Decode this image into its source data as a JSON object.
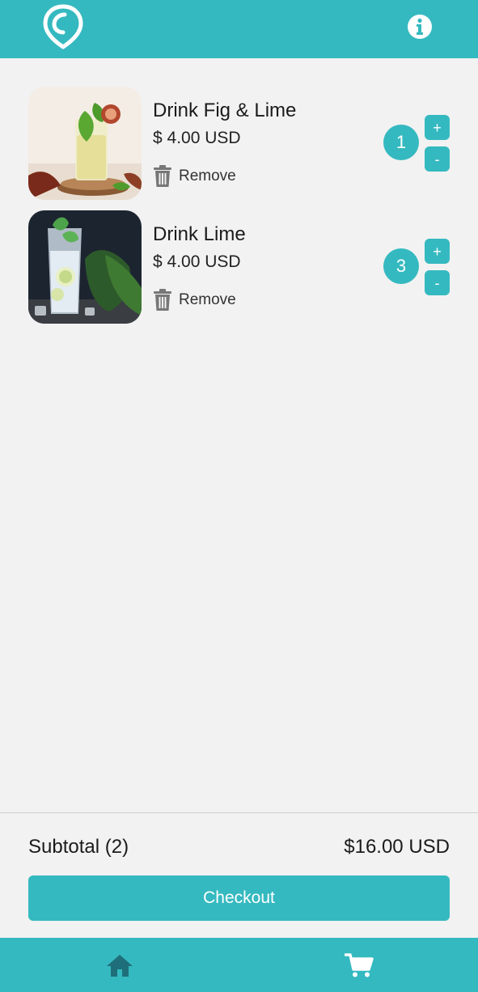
{
  "header": {
    "logo_icon": "location-pin-logo",
    "info_icon": "info-icon",
    "color": "#35b9c0"
  },
  "cart": {
    "items": [
      {
        "name": "Drink Fig & Lime",
        "price": "$ 4.00 USD",
        "remove_label": "Remove",
        "quantity": "1",
        "plus_label": "+",
        "minus_label": "-"
      },
      {
        "name": "Drink Lime",
        "price": "$ 4.00 USD",
        "remove_label": "Remove",
        "quantity": "3",
        "plus_label": "+",
        "minus_label": "-"
      }
    ]
  },
  "summary": {
    "subtotal_label": "Subtotal (2)",
    "subtotal_value": "$16.00 USD",
    "checkout_label": "Checkout"
  },
  "nav": {
    "items": [
      {
        "icon": "home-icon",
        "active": false
      },
      {
        "icon": "cart-icon",
        "active": true
      }
    ]
  },
  "colors": {
    "accent": "#35b9c0",
    "background": "#f2f2f2",
    "inactive_nav_icon": "#1f6f7a",
    "active_nav_icon": "#ffffff"
  }
}
